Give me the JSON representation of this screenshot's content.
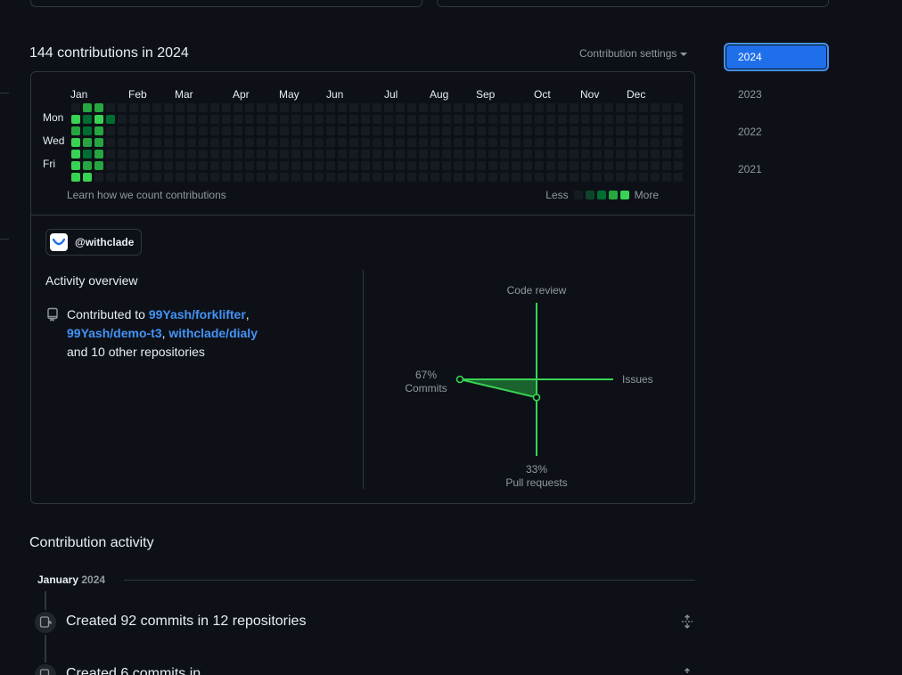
{
  "contributions": {
    "title": "144 contributions in 2024",
    "settings_label": "Contribution settings",
    "months": [
      "Jan",
      "Feb",
      "Mar",
      "Apr",
      "May",
      "Jun",
      "Jul",
      "Aug",
      "Sep",
      "Oct",
      "Nov",
      "Dec"
    ],
    "days": [
      "Mon",
      "Wed",
      "Fri"
    ],
    "learn_link": "Learn how we count contributions",
    "legend_less": "Less",
    "legend_more": "More",
    "level_colors": [
      "#161b22",
      "#0e4429",
      "#006d32",
      "#26a641",
      "#39d353"
    ],
    "active_cells": [
      {
        "week": 0,
        "day": 1,
        "level": 4
      },
      {
        "week": 0,
        "day": 2,
        "level": 3
      },
      {
        "week": 0,
        "day": 3,
        "level": 4
      },
      {
        "week": 0,
        "day": 4,
        "level": 4
      },
      {
        "week": 0,
        "day": 5,
        "level": 4
      },
      {
        "week": 0,
        "day": 6,
        "level": 4
      },
      {
        "week": 1,
        "day": 0,
        "level": 3
      },
      {
        "week": 1,
        "day": 1,
        "level": 2
      },
      {
        "week": 1,
        "day": 2,
        "level": 2
      },
      {
        "week": 1,
        "day": 3,
        "level": 3
      },
      {
        "week": 1,
        "day": 4,
        "level": 2
      },
      {
        "week": 1,
        "day": 5,
        "level": 3
      },
      {
        "week": 1,
        "day": 6,
        "level": 4
      },
      {
        "week": 2,
        "day": 0,
        "level": 3
      },
      {
        "week": 2,
        "day": 1,
        "level": 4
      },
      {
        "week": 2,
        "day": 2,
        "level": 3
      },
      {
        "week": 2,
        "day": 3,
        "level": 3
      },
      {
        "week": 2,
        "day": 4,
        "level": 3
      },
      {
        "week": 2,
        "day": 5,
        "level": 3
      },
      {
        "week": 3,
        "day": 1,
        "level": 2
      }
    ]
  },
  "org": {
    "name": "@withclade"
  },
  "overview": {
    "title": "Activity overview",
    "contributed_to": "Contributed to",
    "repos": [
      "99Yash/forklifter",
      "99Yash/demo-t3",
      "withclade/dialy"
    ],
    "sep1": ",",
    "sep2": ",",
    "others": "and 10 other repositories",
    "radar": {
      "code_review": {
        "label": "Code review",
        "pct": 0
      },
      "issues": {
        "label": "Issues",
        "pct": 0
      },
      "commits": {
        "label": "Commits",
        "pct_label": "67%",
        "pct": 67
      },
      "pull_requests": {
        "label": "Pull requests",
        "pct_label": "33%",
        "pct": 33
      },
      "line_color": "#39d353",
      "fill_color": "#26a641"
    }
  },
  "years": [
    "2024",
    "2023",
    "2022",
    "2021"
  ],
  "activity": {
    "title": "Contribution activity",
    "month": "January",
    "year": "2024",
    "items": [
      {
        "text": "Created 92 commits in 12 repositories"
      },
      {
        "text": "Created 6 commits in"
      }
    ]
  }
}
